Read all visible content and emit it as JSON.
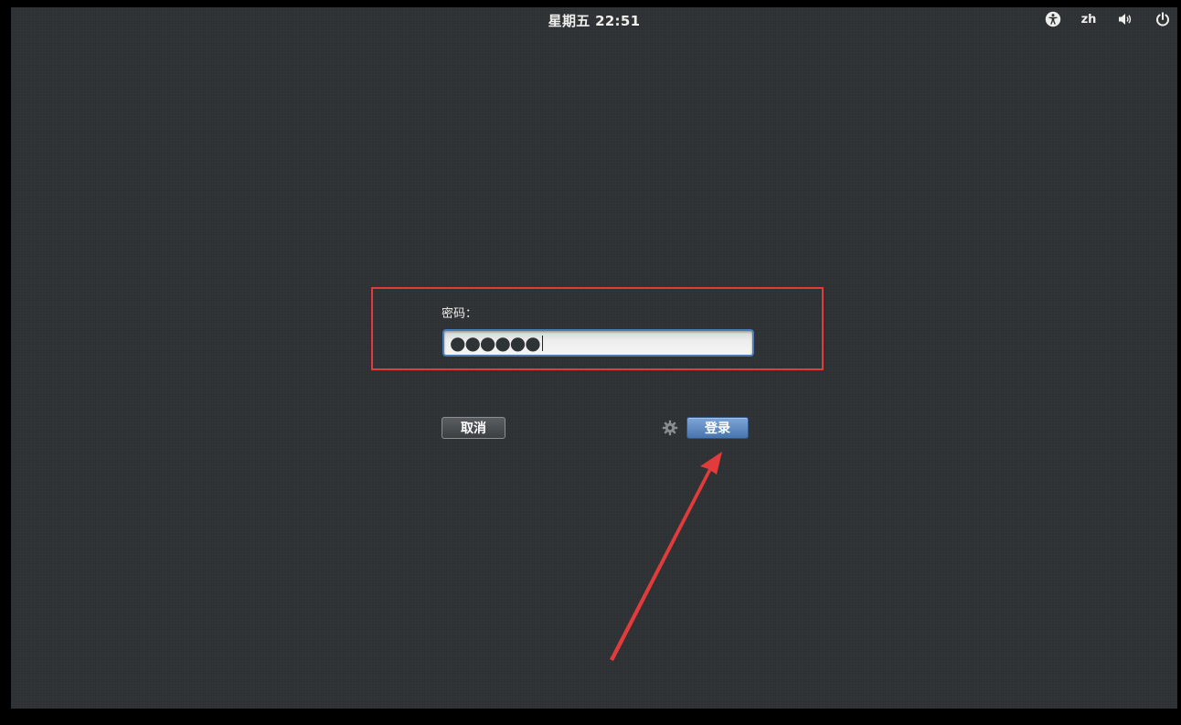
{
  "topbar": {
    "clock": "星期五 22:51",
    "language": "zh",
    "icons": [
      "accessibility-icon",
      "volume-icon",
      "power-icon"
    ]
  },
  "login": {
    "password_label": "密码：",
    "password_mask": "●●●●●●",
    "cancel_label": "取消",
    "login_label": "登录"
  },
  "colors": {
    "background": "#2e3134",
    "accent": "#4a7bb6",
    "annotation": "#e23b3b"
  }
}
